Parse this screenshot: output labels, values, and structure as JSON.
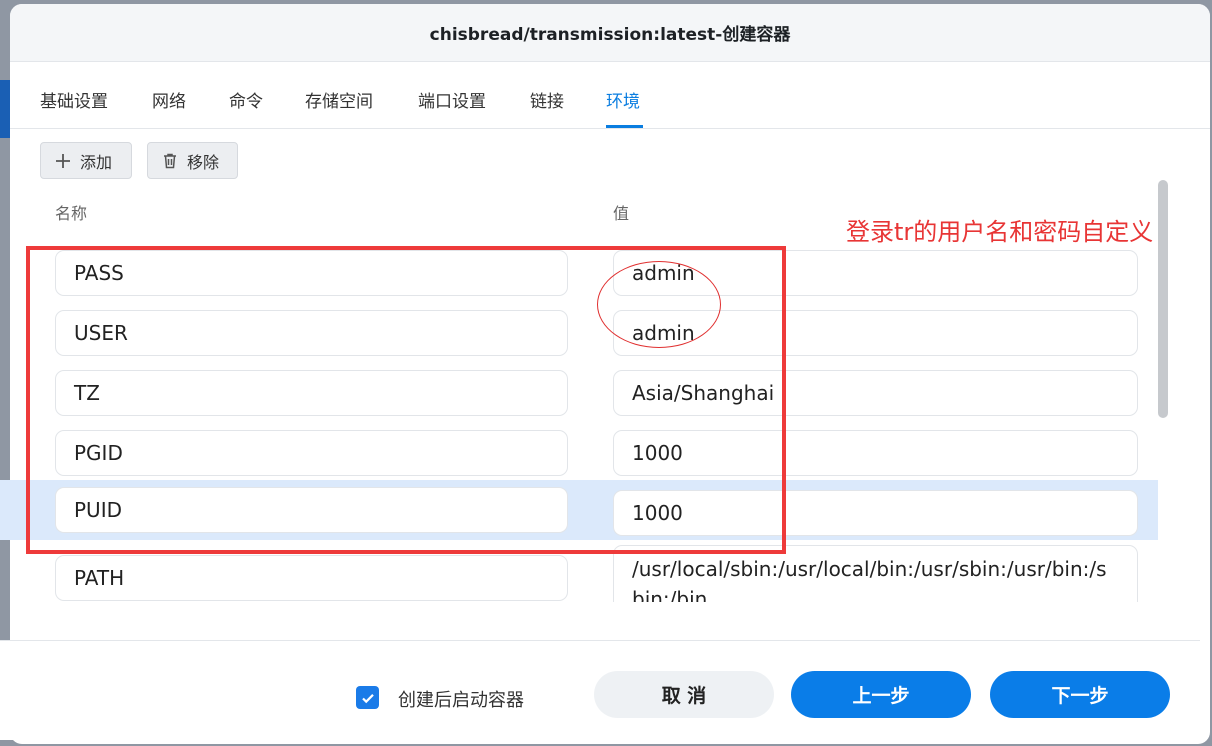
{
  "dialog": {
    "title": "chisbread/transmission:latest-创建容器"
  },
  "tabs": [
    {
      "label": "基础设置",
      "active": false
    },
    {
      "label": "网络",
      "active": false
    },
    {
      "label": "命令",
      "active": false
    },
    {
      "label": "存储空间",
      "active": false
    },
    {
      "label": "端口设置",
      "active": false
    },
    {
      "label": "链接",
      "active": false
    },
    {
      "label": "环境",
      "active": true
    }
  ],
  "toolbar": {
    "add_label": "添加",
    "remove_label": "移除",
    "add_icon": "plus-icon",
    "remove_icon": "trash-icon"
  },
  "columns": {
    "name": "名称",
    "value": "值"
  },
  "annotation": {
    "text": "登录tr的用户名和密码自定义",
    "color": "#ee3a3a"
  },
  "env_vars": [
    {
      "name": "PASS",
      "value": "admin",
      "selected": false
    },
    {
      "name": "USER",
      "value": "admin",
      "selected": false
    },
    {
      "name": "TZ",
      "value": "Asia/Shanghai",
      "selected": false
    },
    {
      "name": "PGID",
      "value": "1000",
      "selected": false
    },
    {
      "name": "PUID",
      "value": "1000",
      "selected": true
    },
    {
      "name": "PATH",
      "value": "/usr/local/sbin:/usr/local/bin:/usr/sbin:/usr/bin:/sbin:/bin",
      "selected": false
    }
  ],
  "footer": {
    "autostart_label": "创建后启动容器",
    "autostart_checked": true,
    "cancel_label": "取 消",
    "prev_label": "上一步",
    "next_label": "下一步"
  },
  "colors": {
    "accent": "#0a7de8",
    "selected_row": "#dbe9fb"
  }
}
